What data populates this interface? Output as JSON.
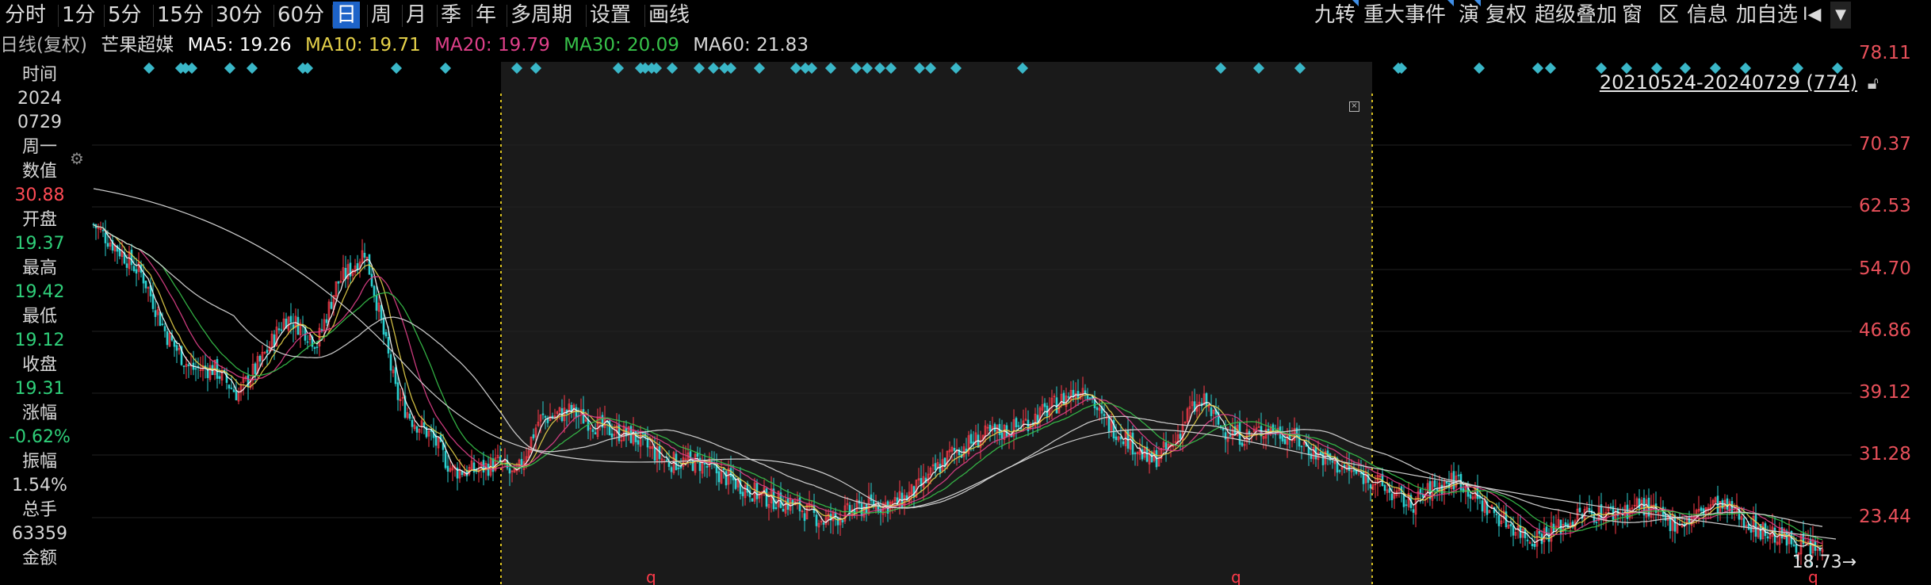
{
  "toolbar": {
    "periods": [
      {
        "label": "分时",
        "active": false
      },
      {
        "label": "1分",
        "active": false
      },
      {
        "label": "5分",
        "active": false
      },
      {
        "label": "15分",
        "active": false
      },
      {
        "label": "30分",
        "active": false
      },
      {
        "label": "60分",
        "active": false
      },
      {
        "label": "日",
        "active": true
      },
      {
        "label": "周",
        "active": false
      },
      {
        "label": "月",
        "active": false
      },
      {
        "label": "季",
        "active": false
      },
      {
        "label": "年",
        "active": false
      },
      {
        "label": "多周期",
        "active": false
      },
      {
        "label": "设置",
        "active": false
      },
      {
        "label": "画线",
        "active": false
      }
    ],
    "right": [
      "九转",
      "重大事件",
      "演",
      "复权",
      "超级叠加",
      "窗",
      "区",
      "信息",
      "加自选"
    ],
    "first_icon": "skip-to-first-icon",
    "dropdown_icon": "dropdown-icon"
  },
  "ma_bar": {
    "period": "日线(复权)",
    "stock_name": "芒果超媒",
    "ma5": "MA5: 19.26",
    "ma10": "MA10: 19.71",
    "ma20": "MA20: 19.79",
    "ma30": "MA30: 20.09",
    "ma60": "MA60: 21.83"
  },
  "info_panel": {
    "time_label": "时间",
    "year": "2024",
    "date": "0729",
    "weekday": "周一",
    "value_label": "数值",
    "value": "30.88",
    "open_label": "开盘",
    "open": "19.37",
    "high_label": "最高",
    "high": "19.42",
    "low_label": "最低",
    "low": "19.12",
    "close_label": "收盘",
    "close": "19.31",
    "change_label": "涨幅",
    "change": "-0.62%",
    "amp_label": "振幅",
    "amp": "1.54%",
    "vol_label": "总手",
    "vol": "63359",
    "amount_label": "金额"
  },
  "chart": {
    "range_label": "20210524-20240729 (774)",
    "latest_price": "18.73",
    "y_ticks": [
      "78.11",
      "70.37",
      "62.53",
      "54.70",
      "46.86",
      "39.12",
      "31.28",
      "23.44"
    ],
    "marker_q": "q",
    "colors": {
      "bg": "#000000",
      "highlight": "#1a1a1a",
      "up": "#ff3b4a",
      "down": "#2bd0d0",
      "ma5": "#ffffff",
      "ma10": "#e6d24a",
      "ma20": "#e0408a",
      "ma30": "#37c24a",
      "ma60": "#d8d8d8",
      "grid": "#222222",
      "dotted": "#d8c020",
      "event": "#3ab7c8"
    }
  }
}
